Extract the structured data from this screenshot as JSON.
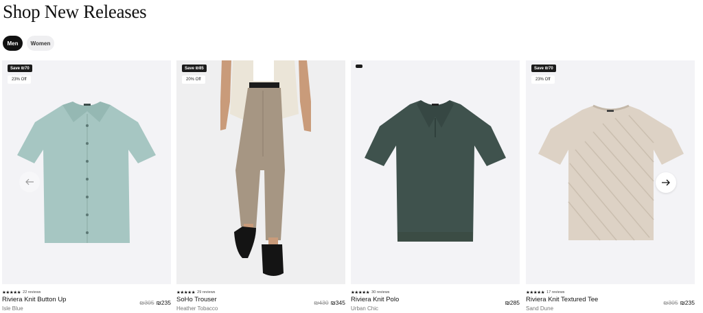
{
  "page": {
    "title": "Shop New Releases"
  },
  "tabs": [
    {
      "label": "Men",
      "active": true
    },
    {
      "label": "Women",
      "active": false
    }
  ],
  "currency_symbol": "₪",
  "products": [
    {
      "name": "Riviera Knit Button Up",
      "color": "Isle Blue",
      "rating": 5,
      "stars": "★★★★★",
      "reviews": "22 reviews",
      "original_price": "₪305",
      "price": "₪235",
      "save_badge": "Save ₪70",
      "discount_badge": "23% Off",
      "garment_color": "#a6c6c2"
    },
    {
      "name": "SoHo Trouser",
      "color": "Heather Tobacco",
      "rating": 4.5,
      "stars": "★★★★★",
      "reviews": "29 reviews",
      "original_price": "₪430",
      "price": "₪345",
      "save_badge": "Save ₪85",
      "discount_badge": "20% Off",
      "garment_color": "#a69683"
    },
    {
      "name": "Riviera Knit Polo",
      "color": "Urban Chic",
      "rating": 4.5,
      "stars": "★★★★★",
      "reviews": "30 reviews",
      "original_price": "",
      "price": "₪285",
      "save_badge": "",
      "discount_badge": "",
      "garment_color": "#3f524d"
    },
    {
      "name": "Riviera Knit Textured Tee",
      "color": "Sand Dune",
      "rating": 4.5,
      "stars": "★★★★★",
      "reviews": "17 reviews",
      "original_price": "₪305",
      "price": "₪235",
      "save_badge": "Save ₪70",
      "discount_badge": "23% Off",
      "garment_color": "#ddd2c5"
    }
  ],
  "carousel": {
    "prev_icon": "arrow-left-icon",
    "next_icon": "arrow-right-icon"
  }
}
